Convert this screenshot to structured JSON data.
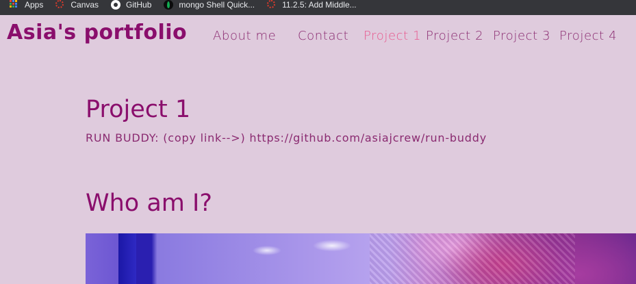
{
  "bookmarks": [
    {
      "label": "Apps",
      "icon": "apps-grid-icon"
    },
    {
      "label": "Canvas",
      "icon": "canvas-icon"
    },
    {
      "label": "GitHub",
      "icon": "github-icon"
    },
    {
      "label": "mongo Shell Quick...",
      "icon": "mongodb-leaf-icon"
    },
    {
      "label": "11.2.5: Add Middle...",
      "icon": "canvas-icon"
    }
  ],
  "site": {
    "title": "Asia's portfolio"
  },
  "nav": {
    "items": [
      {
        "label": "About me",
        "active": false
      },
      {
        "label": "Contact",
        "active": false
      },
      {
        "label": "Project 1",
        "active": true
      },
      {
        "label": "Project 2",
        "active": false
      },
      {
        "label": "Project 3",
        "active": false
      },
      {
        "label": "Project 4",
        "active": false
      }
    ]
  },
  "main": {
    "project_heading": "Project 1",
    "project_desc": "RUN BUDDY: (copy link-->) https://github.com/asiajcrew/run-buddy",
    "about_heading": "Who am I?"
  },
  "colors": {
    "page_background": "#dfcbdd",
    "title": "#8a0e6c",
    "nav_text": "#8a2a70",
    "nav_active": "#e8578d",
    "bookmarks_bar": "#35363a"
  }
}
